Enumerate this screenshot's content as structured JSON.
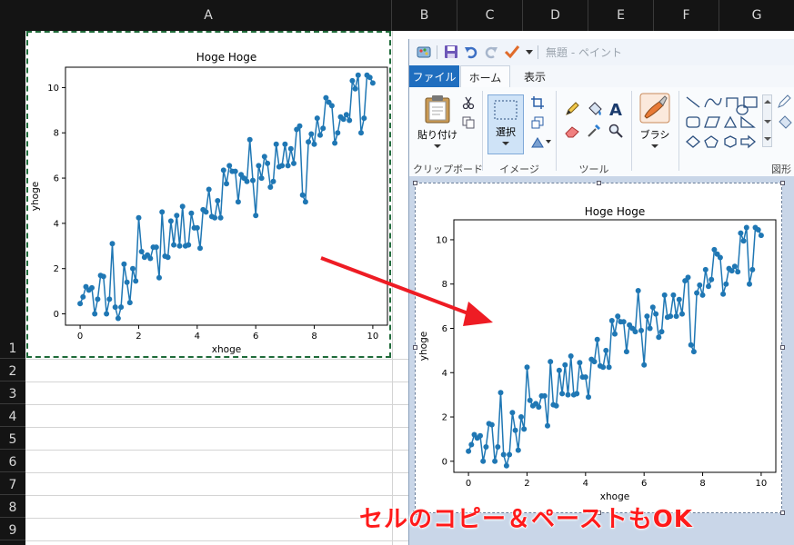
{
  "excel": {
    "columns": [
      "A",
      "B",
      "C",
      "D",
      "E",
      "F",
      "G"
    ],
    "rows": [
      "1",
      "2",
      "3",
      "4",
      "5",
      "6",
      "7",
      "8",
      "9"
    ]
  },
  "paint": {
    "title": "無題 - ペイント",
    "tabs": {
      "file": "ファイル",
      "home": "ホーム",
      "view": "表示"
    },
    "groups": {
      "clipboard": "クリップボード",
      "image": "イメージ",
      "tools": "ツール",
      "shapes": "図形"
    },
    "buttons": {
      "paste": "貼り付け",
      "select": "選択",
      "brush": "ブラシ"
    }
  },
  "caption": "セルのコピー＆ペーストもOK",
  "colors": {
    "series": "#1f77b4",
    "arrow": "#ee1c24",
    "file_tab": "#1f6ebf",
    "selection": "#1f6b3a"
  },
  "chart_data": {
    "type": "line",
    "title": "Hoge Hoge",
    "xlabel": "xhoge",
    "ylabel": "yhoge",
    "xlim": [
      -0.5,
      10.5
    ],
    "ylim": [
      -0.5,
      10.9
    ],
    "xticks": [
      "0",
      "2",
      "4",
      "6",
      "8",
      "10"
    ],
    "yticks": [
      "0",
      "2",
      "4",
      "6",
      "8",
      "10"
    ],
    "marker": "circle",
    "series": [
      {
        "x": [
          0,
          0.1,
          0.2,
          0.3,
          0.4,
          0.5,
          0.6,
          0.7,
          0.8,
          0.9,
          1.0,
          1.1,
          1.2,
          1.3,
          1.4,
          1.5,
          1.6,
          1.7,
          1.8,
          1.9,
          2.0,
          2.1,
          2.2,
          2.3,
          2.4,
          2.5,
          2.6,
          2.7,
          2.8,
          2.9,
          3.0,
          3.1,
          3.2,
          3.3,
          3.4,
          3.5,
          3.6,
          3.7,
          3.8,
          3.9,
          4.0,
          4.1,
          4.2,
          4.3,
          4.4,
          4.5,
          4.6,
          4.7,
          4.8,
          4.9,
          5.0,
          5.1,
          5.2,
          5.3,
          5.4,
          5.5,
          5.6,
          5.7,
          5.8,
          5.9,
          6.0,
          6.1,
          6.2,
          6.3,
          6.4,
          6.5,
          6.6,
          6.7,
          6.8,
          6.9,
          7.0,
          7.1,
          7.2,
          7.3,
          7.4,
          7.5,
          7.6,
          7.7,
          7.8,
          7.9,
          8.0,
          8.1,
          8.2,
          8.3,
          8.4,
          8.5,
          8.6,
          8.7,
          8.8,
          8.9,
          9.0,
          9.1,
          9.2,
          9.3,
          9.4,
          9.5,
          9.6,
          9.7,
          9.8,
          9.9,
          10.0
        ],
        "y": [
          0.45,
          0.75,
          1.2,
          1.05,
          1.15,
          0.0,
          0.65,
          1.7,
          1.65,
          0.0,
          0.65,
          3.1,
          0.3,
          -0.2,
          0.3,
          2.2,
          1.4,
          0.5,
          2.0,
          1.45,
          4.25,
          2.75,
          2.5,
          2.6,
          2.45,
          2.95,
          2.95,
          1.6,
          4.5,
          2.55,
          2.5,
          4.1,
          3.05,
          4.35,
          3.0,
          4.75,
          3.0,
          3.05,
          4.45,
          3.8,
          3.8,
          2.9,
          4.6,
          4.5,
          5.5,
          4.3,
          4.25,
          5.0,
          4.25,
          6.35,
          5.75,
          6.55,
          6.3,
          6.3,
          4.95,
          6.15,
          6.0,
          5.85,
          7.7,
          5.9,
          4.35,
          6.55,
          6.0,
          6.95,
          6.65,
          5.6,
          5.85,
          7.5,
          6.5,
          6.55,
          7.5,
          6.55,
          7.3,
          6.65,
          8.15,
          8.3,
          5.25,
          4.95,
          7.6,
          7.95,
          7.5,
          8.65,
          7.9,
          8.2,
          9.55,
          9.35,
          9.2,
          7.55,
          8.0,
          8.7,
          8.6,
          8.8,
          8.55,
          10.3,
          9.95,
          10.55,
          8.0,
          8.65,
          10.55,
          10.45,
          10.2
        ]
      }
    ]
  }
}
